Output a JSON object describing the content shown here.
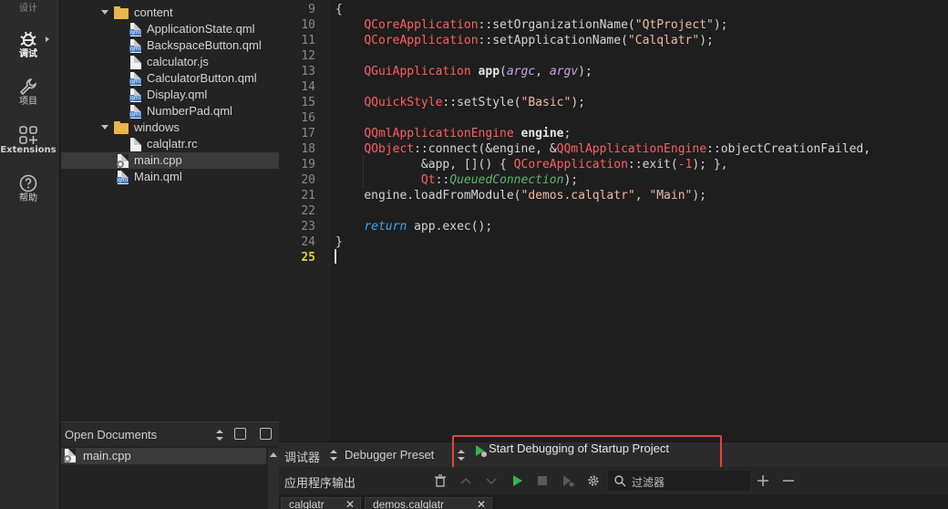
{
  "modes": [
    {
      "id": "design",
      "label": "设计"
    },
    {
      "id": "debug",
      "label": "调试"
    },
    {
      "id": "projects",
      "label": "项目"
    },
    {
      "id": "extensions",
      "label": "Extensions"
    },
    {
      "id": "help",
      "label": "帮助"
    }
  ],
  "tree": {
    "folder_content": "content",
    "files_content": [
      "ApplicationState.qml",
      "BackspaceButton.qml",
      "calculator.js",
      "CalculatorButton.qml",
      "Display.qml",
      "NumberPad.qml"
    ],
    "folder_windows": "windows",
    "files_windows": [
      "calqlatr.rc"
    ],
    "main_cpp": "main.cpp",
    "main_qml": "Main.qml"
  },
  "open_documents": {
    "title": "Open Documents",
    "items": [
      "main.cpp"
    ]
  },
  "editor": {
    "line_numbers": [
      "9",
      "10",
      "11",
      "12",
      "13",
      "14",
      "15",
      "16",
      "17",
      "18",
      "19",
      "20",
      "21",
      "22",
      "23",
      "24",
      "25"
    ],
    "current_line": "25",
    "code": {
      "l9": "{",
      "l10": {
        "cls": "QCoreApplication",
        "sep": "::",
        "fn": "setOrganizationName(",
        "str": "\"QtProject\"",
        "end": ");"
      },
      "l11": {
        "cls": "QCoreApplication",
        "sep": "::",
        "fn": "setApplicationName(",
        "str": "\"Calqlatr\"",
        "end": ");"
      },
      "l13": {
        "cls": "QGuiApplication",
        "var": "app",
        "open": "(",
        "p1": "argc",
        "comma": ", ",
        "p2": "argv",
        "end": ");"
      },
      "l15": {
        "cls": "QQuickStyle",
        "sep": "::",
        "fn": "setStyle(",
        "str": "\"Basic\"",
        "end": ");"
      },
      "l17": {
        "cls": "QQmlApplicationEngine",
        "var": "engine",
        "end": ";"
      },
      "l18": {
        "cls": "QObject",
        "sep": "::",
        "fn": "connect(&engine, &",
        "cls2": "QQmlApplicationEngine",
        "sep2": "::",
        "fn2": "objectCreationFailed,"
      },
      "l19": {
        "pre": "&app, []() { ",
        "cls": "QCoreApplication",
        "sep": "::",
        "fn": "exit(",
        "num": "-1",
        "end": "); },"
      },
      "l20": {
        "cls": "Qt",
        "sep": "::",
        "enum": "QueuedConnection",
        "end": ");"
      },
      "l21": {
        "fn": "engine.loadFromModule(",
        "str1": "\"demos.calqlatr\"",
        "comma": ", ",
        "str2": "\"Main\"",
        "end": ");"
      },
      "l23": {
        "kw": "return",
        "rest": " app.exec();"
      },
      "l24": "}"
    }
  },
  "debugger_bar": {
    "debugger_label": "调试器",
    "preset_label": "Debugger Preset",
    "start_label": "Start Debugging of Startup Project"
  },
  "output": {
    "title": "应用程序输出",
    "filter_placeholder": "过滤器",
    "tabs": [
      "calqlatr",
      "demos.calqlatr"
    ]
  }
}
